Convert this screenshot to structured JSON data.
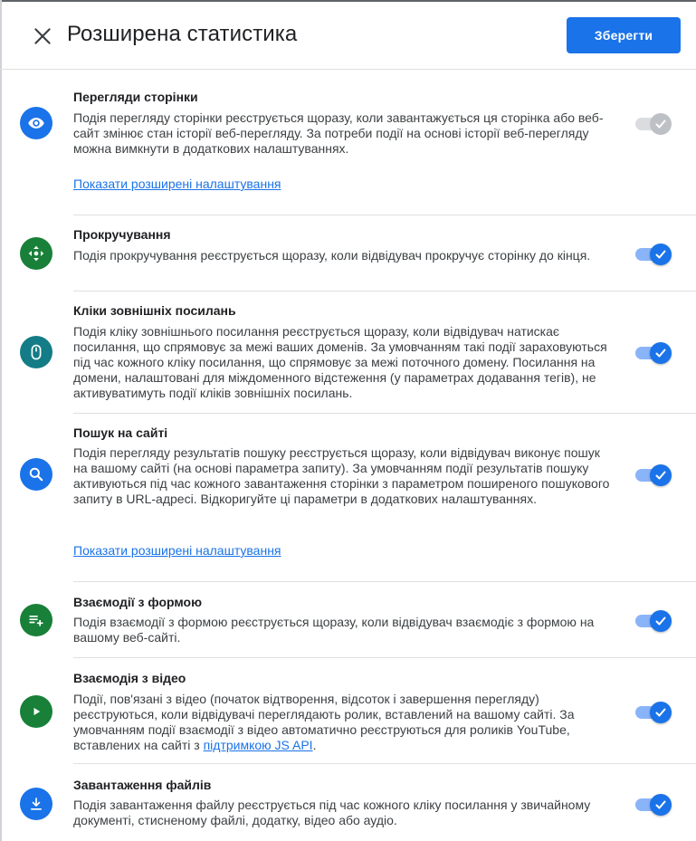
{
  "header": {
    "title": "Розширена статистика",
    "save_label": "Зберегти"
  },
  "colors": {
    "primary": "#1a73e8",
    "green": "#188038",
    "teal": "#137c86",
    "toggle_disabled": "#bdc1c6"
  },
  "sections": [
    {
      "title": "Перегляди сторінки",
      "icon": "eye-icon",
      "description": "Подія перегляду сторінки реєструється щоразу, коли завантажується ця сторінка або веб-сайт змінює стан історії веб-перегляду. За потреби події на основі історії веб-перегляду можна вимкнути в додаткових налаштуваннях.",
      "link": "Показати розширені налаштування",
      "enabled": true,
      "toggle_disabled": true
    },
    {
      "title": "Прокручування",
      "icon": "scroll-arrows-icon",
      "description": "Подія прокручування реєструється щоразу, коли відвідувач прокручує сторінку до кінця.",
      "enabled": true
    },
    {
      "title": "Кліки зовнішніх посилань",
      "icon": "mouse-icon",
      "description": "Подія кліку зовнішнього посилання реєструється щоразу, коли відвідувач натискає посилання, що спрямовує за межі ваших доменів. За умовчанням такі події зараховуються під час кожного кліку посилання, що спрямовує за межі поточного домену. Посилання на домени, налаштовані для міждоменного відстеження (у параметрах додавання тегів), не активуватимуть події кліків зовнішніх посилань.",
      "enabled": true
    },
    {
      "title": "Пошук на сайті",
      "icon": "search-icon",
      "description": "Подія перегляду результатів пошуку реєструється щоразу, коли відвідувач виконує пошук на вашому сайті (на основі параметра запиту). За умовчанням події результатів пошуку активуються під час кожного завантаження сторінки з параметром поширеного пошукового запиту в URL-адресі. Відкоригуйте ці параметри в додаткових налаштуваннях.",
      "link": "Показати розширені налаштування",
      "enabled": true
    },
    {
      "title": "Взаємодії з формою",
      "icon": "playlist-add-icon",
      "description": "Подія взаємодії з формою реєструється щоразу, коли відвідувач взаємодіє з формою на вашому веб-сайті.",
      "enabled": true
    },
    {
      "title": "Взаємодія з відео",
      "icon": "play-icon",
      "description": "Події, пов'язані з відео (початок відтворення, відсоток і завершення перегляду) реєструються, коли відвідувачі переглядають ролик, вставлений на вашому сайті. За умовчанням події взаємодії з відео автоматично реєструються для роликів YouTube, вставлених на сайті з ",
      "description_link": "підтримкою JS API",
      "description_end": ".",
      "enabled": true
    },
    {
      "title": "Завантаження файлів",
      "icon": "download-icon",
      "description": "Подія завантаження файлу реєструється під час кожного кліку посилання у звичайному документі, стисненому файлі, додатку, відео або аудіо.",
      "enabled": true
    }
  ]
}
